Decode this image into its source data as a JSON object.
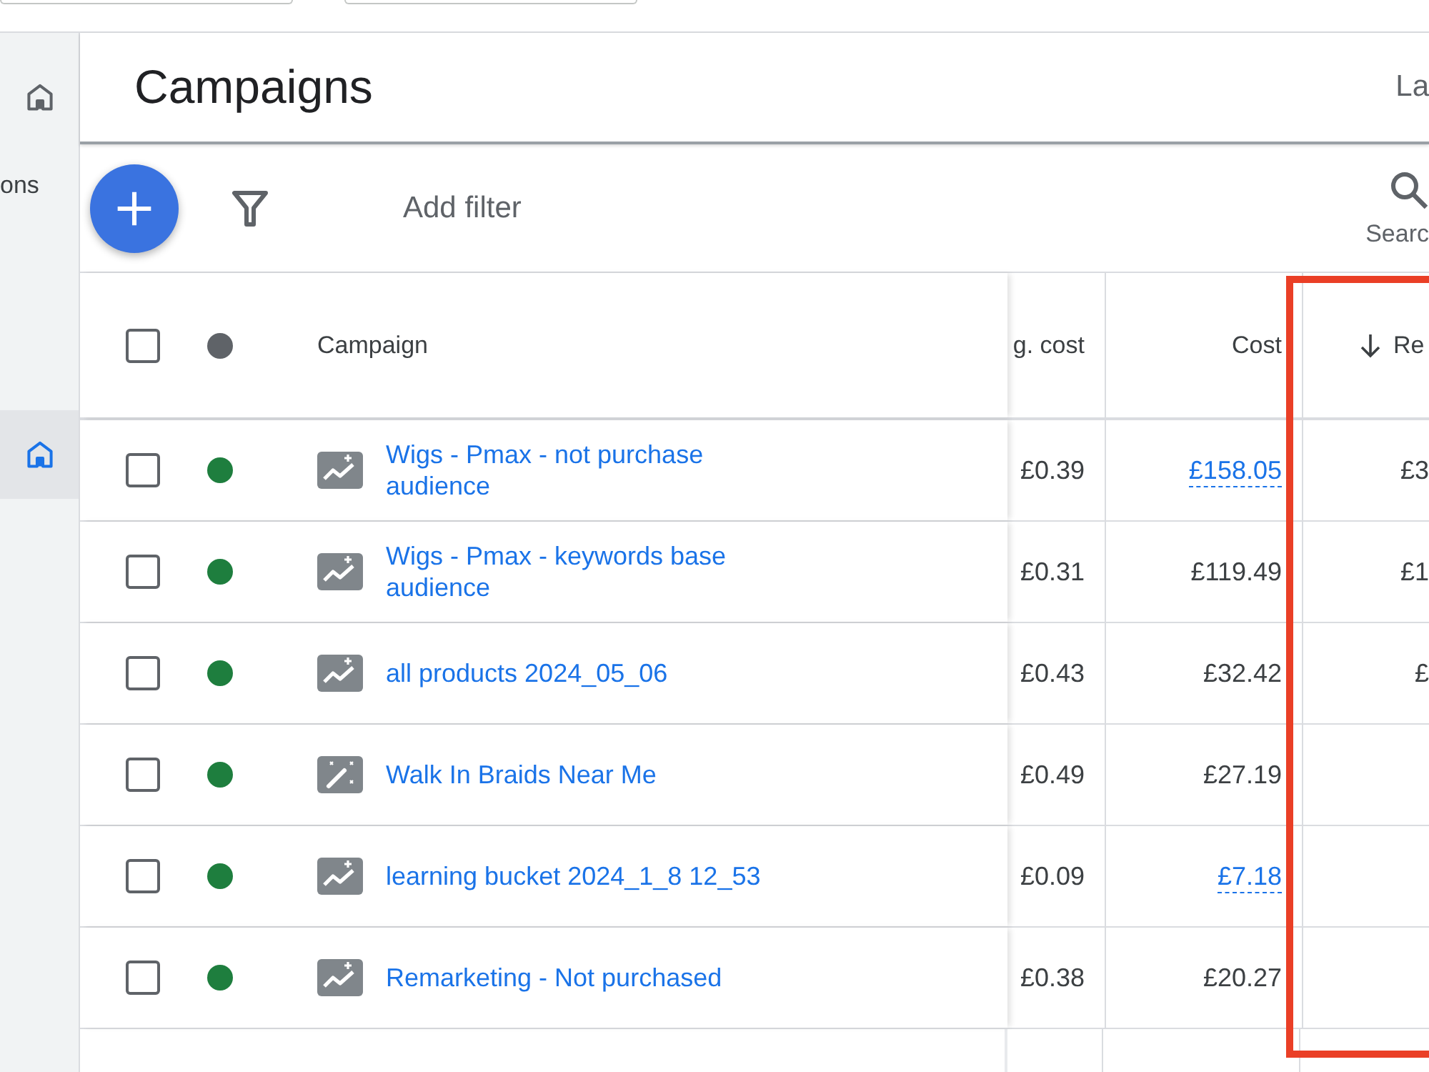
{
  "sidebar": {
    "items": [
      {
        "kind": "icon",
        "selected": false
      },
      {
        "kind": "label",
        "text": "ons"
      },
      {
        "kind": "icon",
        "selected": true
      }
    ]
  },
  "header": {
    "title": "Campaigns",
    "right_text": "La"
  },
  "toolbar": {
    "filter_label": "Add filter",
    "search_label": "Searc"
  },
  "table": {
    "header_checkbox": {
      "checked": false
    },
    "columns": [
      {
        "label": "Campaign",
        "sorted": false,
        "highlighted": false
      },
      {
        "label": "g. cost",
        "sorted": false,
        "highlighted": false
      },
      {
        "label": "Cost",
        "sorted": false,
        "highlighted": false
      },
      {
        "label": "Re",
        "sorted": true,
        "highlighted": true
      }
    ],
    "rows": [
      {
        "checked": false,
        "enabled": true,
        "kind": "performance_max",
        "campaign": "Wigs - Pmax - not purchase audience",
        "avg_cost": "£0.39",
        "cost": "£158.05",
        "cost_underlined": true,
        "column_4": "£3"
      },
      {
        "checked": false,
        "enabled": true,
        "kind": "performance_max",
        "campaign": "Wigs - Pmax - keywords base audience",
        "avg_cost": "£0.31",
        "cost": "£119.49",
        "cost_underlined": false,
        "column_4": "£1"
      },
      {
        "checked": false,
        "enabled": true,
        "kind": "performance_max",
        "campaign": "all products 2024_05_06",
        "avg_cost": "£0.43",
        "cost": "£32.42",
        "cost_underlined": false,
        "column_4": "£"
      },
      {
        "checked": false,
        "enabled": true,
        "kind": "smart",
        "campaign": "Walk In Braids Near Me",
        "avg_cost": "£0.49",
        "cost": "£27.19",
        "cost_underlined": false
      },
      {
        "checked": false,
        "enabled": true,
        "kind": "performance_max",
        "campaign": "learning bucket 2024_1_8 12_53",
        "avg_cost": "£0.09",
        "cost": "£7.18",
        "cost_underlined": true
      },
      {
        "checked": false,
        "enabled": true,
        "kind": "performance_max",
        "campaign": "Remarketing - Not purchased",
        "avg_cost": "£0.38",
        "cost": "£20.27",
        "cost_underlined": false
      }
    ]
  }
}
